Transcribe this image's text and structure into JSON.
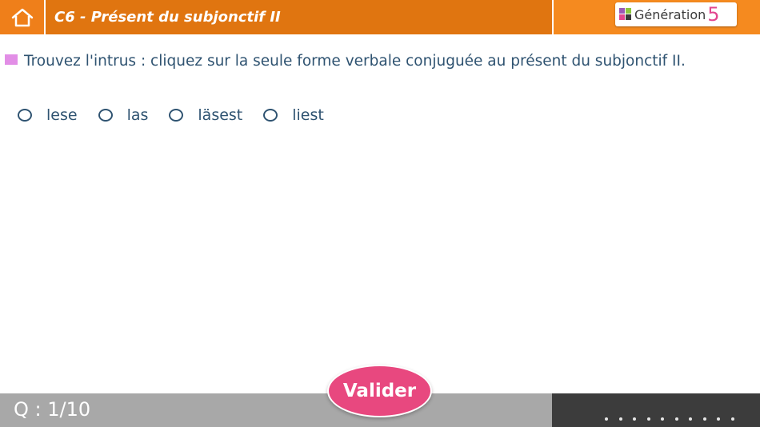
{
  "header": {
    "home_icon": "home-icon",
    "title": "C6 - Présent du subjonctif II",
    "brand_name": "Génération",
    "brand_number": "5",
    "colors": {
      "home_bg": "#ef7f1a",
      "title_bg": "#e07510",
      "brand_bg": "#f58a1f"
    }
  },
  "question": {
    "text": "Trouvez l'intrus : cliquez sur la seule forme verbale conjuguée au présent du subjonctif II.",
    "marker_color": "#e28ee6",
    "options": [
      {
        "label": "lese"
      },
      {
        "label": "las"
      },
      {
        "label": "läsest"
      },
      {
        "label": "liest"
      }
    ]
  },
  "footer": {
    "counter": "Q : 1/10",
    "validate_label": "Valider",
    "progress_dots": 10,
    "validate_color": "#e8487f"
  }
}
